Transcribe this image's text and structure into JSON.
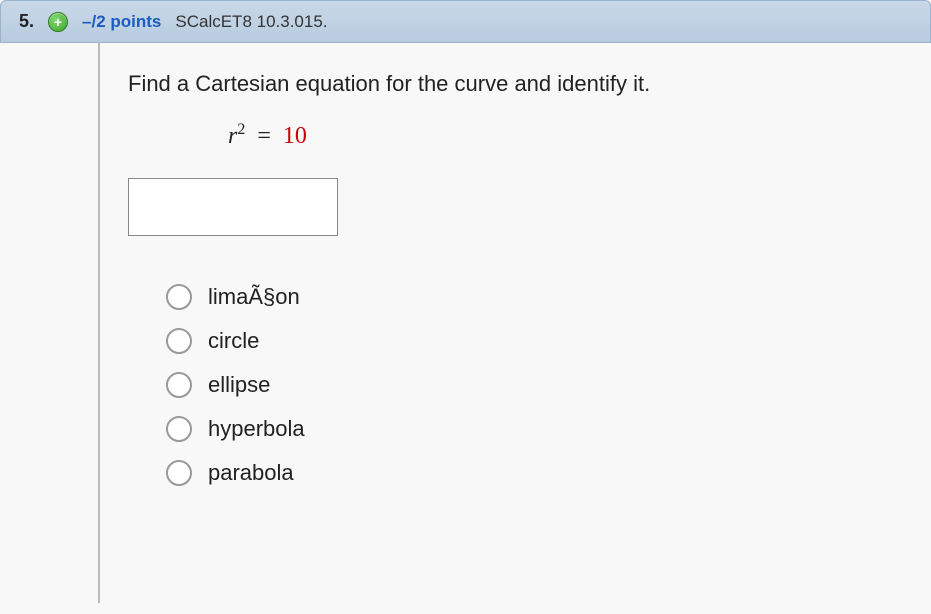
{
  "header": {
    "question_number": "5.",
    "expand_symbol": "+",
    "points": "–/2 points",
    "source": "SCalcET8 10.3.015."
  },
  "question": {
    "prompt": "Find a Cartesian equation for the curve and identify it.",
    "equation_var": "r",
    "equation_exp": "2",
    "equation_eq": "=",
    "equation_value": "10",
    "answer_value": ""
  },
  "options": [
    {
      "label": "limaÃ§on"
    },
    {
      "label": "circle"
    },
    {
      "label": "ellipse"
    },
    {
      "label": "hyperbola"
    },
    {
      "label": "parabola"
    }
  ]
}
